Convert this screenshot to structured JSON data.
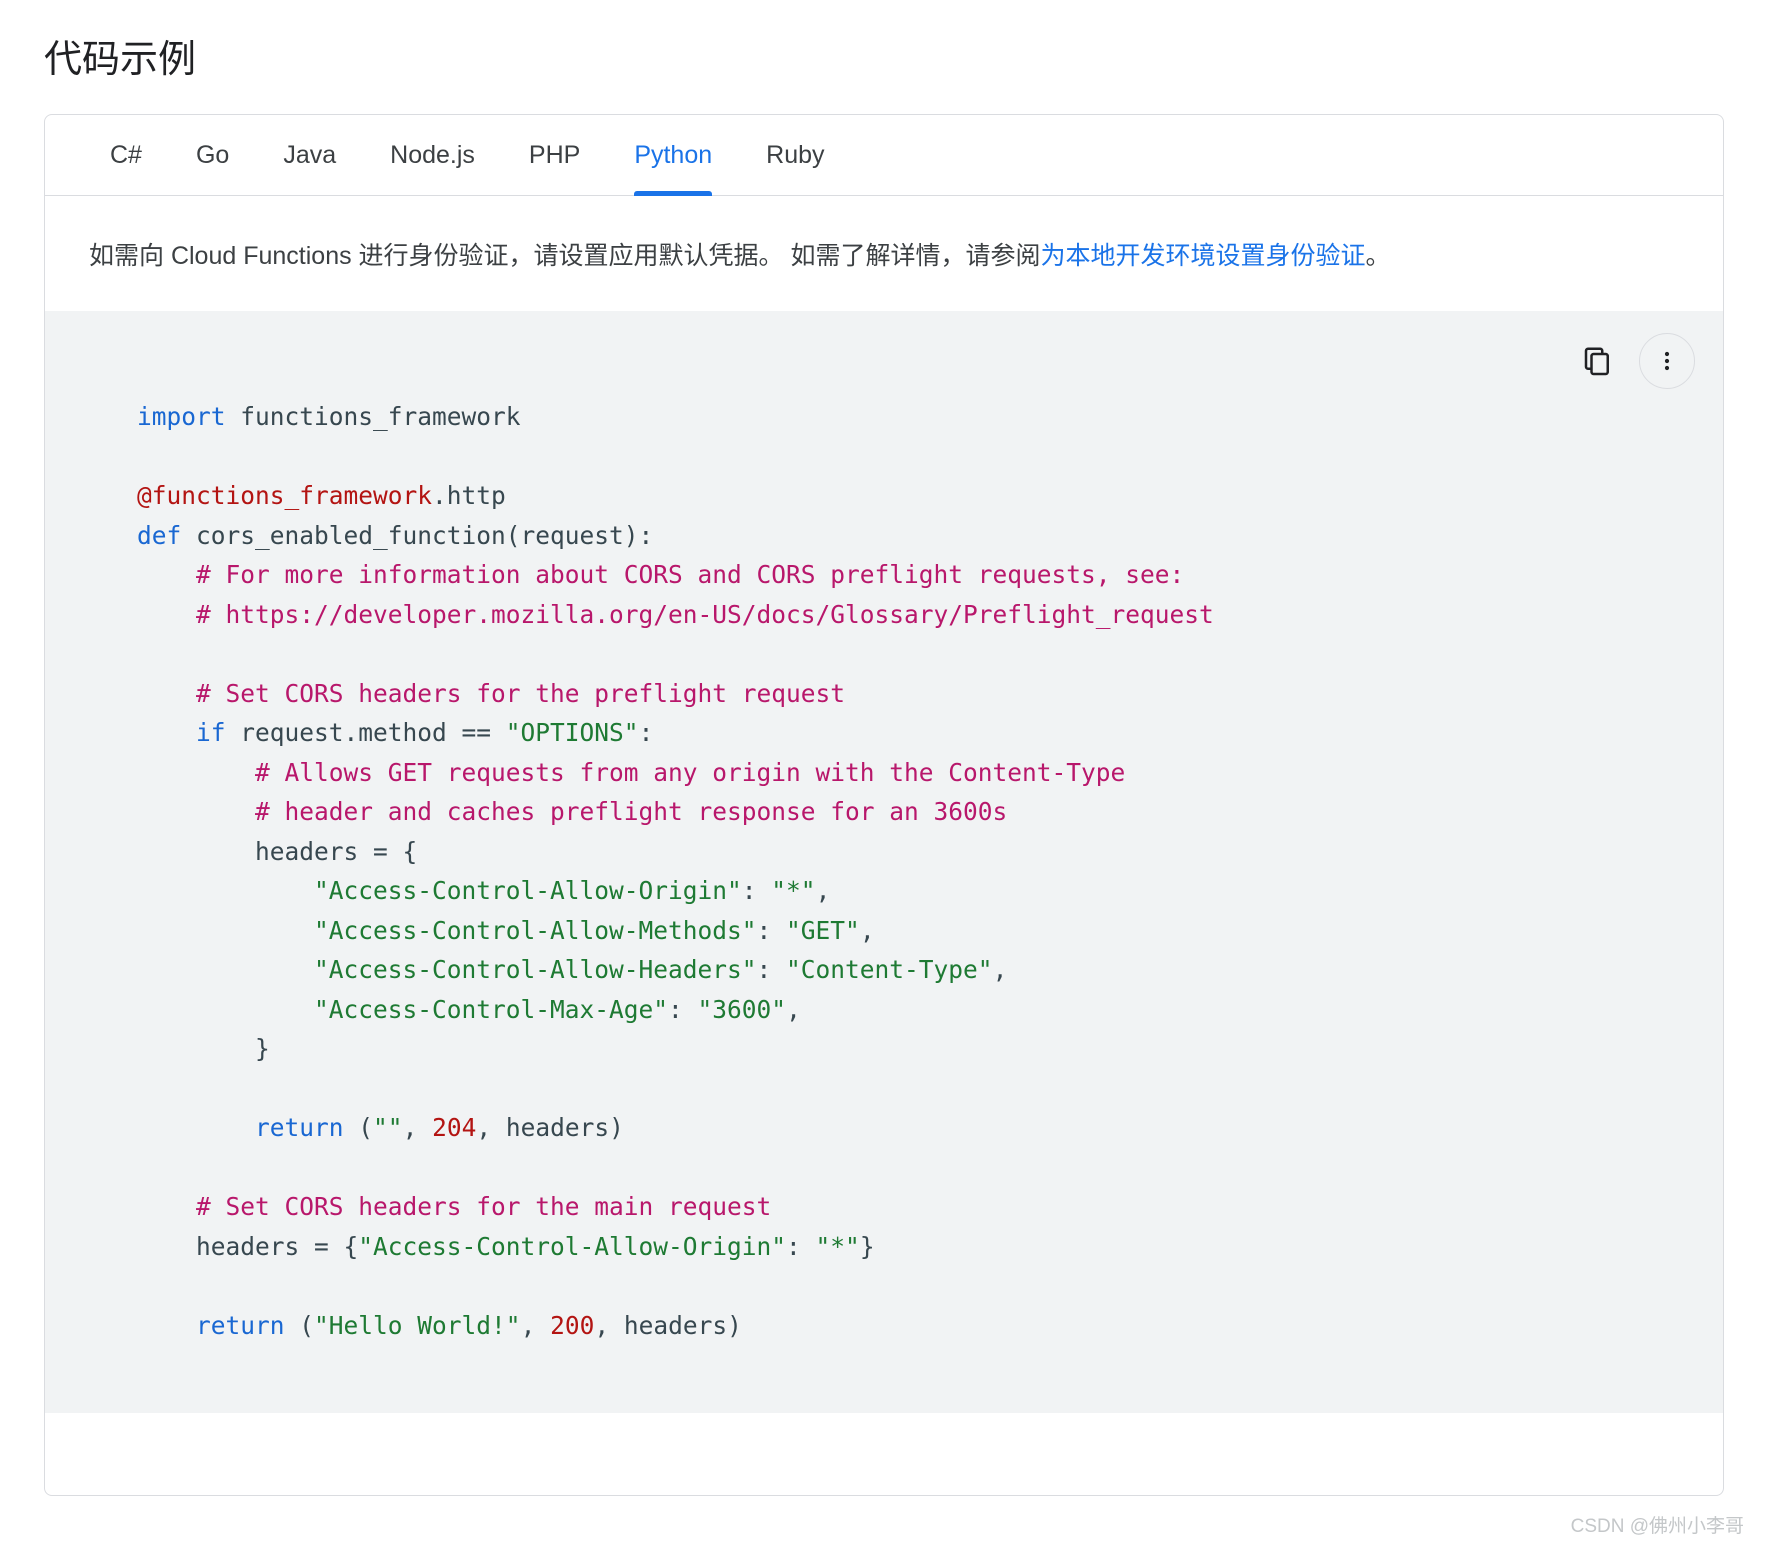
{
  "page_title": "代码示例",
  "tabs": [
    {
      "label": "C#",
      "active": false
    },
    {
      "label": "Go",
      "active": false
    },
    {
      "label": "Java",
      "active": false
    },
    {
      "label": "Node.js",
      "active": false
    },
    {
      "label": "PHP",
      "active": false
    },
    {
      "label": "Python",
      "active": true
    },
    {
      "label": "Ruby",
      "active": false
    }
  ],
  "description": {
    "text_before_link": "如需向 Cloud Functions 进行身份验证，请设置应用默认凭据。 如需了解详情，请参阅",
    "link_text": "为本地开发环境设置身份验证",
    "text_after_link": "。"
  },
  "code_actions": {
    "copy_label": "copy-icon",
    "more_label": "more-vert-icon"
  },
  "code": {
    "language": "Python",
    "lines": [
      [
        {
          "t": "import",
          "c": "kw"
        },
        {
          "t": " functions_framework",
          "c": "pln"
        }
      ],
      [],
      [
        {
          "t": "@functions_framework",
          "c": "dec"
        },
        {
          "t": ".http",
          "c": "pln"
        }
      ],
      [
        {
          "t": "def",
          "c": "kw"
        },
        {
          "t": " cors_enabled_function(request):",
          "c": "pln"
        }
      ],
      [
        {
          "t": "    # For more information about CORS and CORS preflight requests, see:",
          "c": "com"
        }
      ],
      [
        {
          "t": "    # https://developer.mozilla.org/en-US/docs/Glossary/Preflight_request",
          "c": "com"
        }
      ],
      [],
      [
        {
          "t": "    # Set CORS headers for the preflight request",
          "c": "com"
        }
      ],
      [
        {
          "t": "    ",
          "c": "pln"
        },
        {
          "t": "if",
          "c": "kw"
        },
        {
          "t": " request.method == ",
          "c": "pln"
        },
        {
          "t": "\"OPTIONS\"",
          "c": "str"
        },
        {
          "t": ":",
          "c": "pln"
        }
      ],
      [
        {
          "t": "        # Allows GET requests from any origin with the Content-Type",
          "c": "com"
        }
      ],
      [
        {
          "t": "        # header and caches preflight response for an 3600s",
          "c": "com"
        }
      ],
      [
        {
          "t": "        headers = {",
          "c": "pln"
        }
      ],
      [
        {
          "t": "            ",
          "c": "pln"
        },
        {
          "t": "\"Access-Control-Allow-Origin\"",
          "c": "str"
        },
        {
          "t": ": ",
          "c": "pln"
        },
        {
          "t": "\"*\"",
          "c": "str"
        },
        {
          "t": ",",
          "c": "pln"
        }
      ],
      [
        {
          "t": "            ",
          "c": "pln"
        },
        {
          "t": "\"Access-Control-Allow-Methods\"",
          "c": "str"
        },
        {
          "t": ": ",
          "c": "pln"
        },
        {
          "t": "\"GET\"",
          "c": "str"
        },
        {
          "t": ",",
          "c": "pln"
        }
      ],
      [
        {
          "t": "            ",
          "c": "pln"
        },
        {
          "t": "\"Access-Control-Allow-Headers\"",
          "c": "str"
        },
        {
          "t": ": ",
          "c": "pln"
        },
        {
          "t": "\"Content-Type\"",
          "c": "str"
        },
        {
          "t": ",",
          "c": "pln"
        }
      ],
      [
        {
          "t": "            ",
          "c": "pln"
        },
        {
          "t": "\"Access-Control-Max-Age\"",
          "c": "str"
        },
        {
          "t": ": ",
          "c": "pln"
        },
        {
          "t": "\"3600\"",
          "c": "str"
        },
        {
          "t": ",",
          "c": "pln"
        }
      ],
      [
        {
          "t": "        }",
          "c": "pln"
        }
      ],
      [],
      [
        {
          "t": "        ",
          "c": "pln"
        },
        {
          "t": "return",
          "c": "kw"
        },
        {
          "t": " (",
          "c": "pln"
        },
        {
          "t": "\"\"",
          "c": "str"
        },
        {
          "t": ", ",
          "c": "pln"
        },
        {
          "t": "204",
          "c": "num"
        },
        {
          "t": ", headers)",
          "c": "pln"
        }
      ],
      [],
      [
        {
          "t": "    # Set CORS headers for the main request",
          "c": "com"
        }
      ],
      [
        {
          "t": "    headers = {",
          "c": "pln"
        },
        {
          "t": "\"Access-Control-Allow-Origin\"",
          "c": "str"
        },
        {
          "t": ": ",
          "c": "pln"
        },
        {
          "t": "\"*\"",
          "c": "str"
        },
        {
          "t": "}",
          "c": "pln"
        }
      ],
      [],
      [
        {
          "t": "    ",
          "c": "pln"
        },
        {
          "t": "return",
          "c": "kw"
        },
        {
          "t": " (",
          "c": "pln"
        },
        {
          "t": "\"Hello World!\"",
          "c": "str"
        },
        {
          "t": ", ",
          "c": "pln"
        },
        {
          "t": "200",
          "c": "num"
        },
        {
          "t": ", headers)",
          "c": "pln"
        }
      ]
    ]
  },
  "watermark": "CSDN @佛州小李哥",
  "colors": {
    "accent": "#1a73e8",
    "keyword": "#1967d2",
    "decorator": "#b31412",
    "comment": "#b8176b",
    "string": "#1e7a33",
    "number": "#b31412",
    "plain": "#37474f",
    "code_bg": "#f1f3f4",
    "border": "#dadce0"
  }
}
